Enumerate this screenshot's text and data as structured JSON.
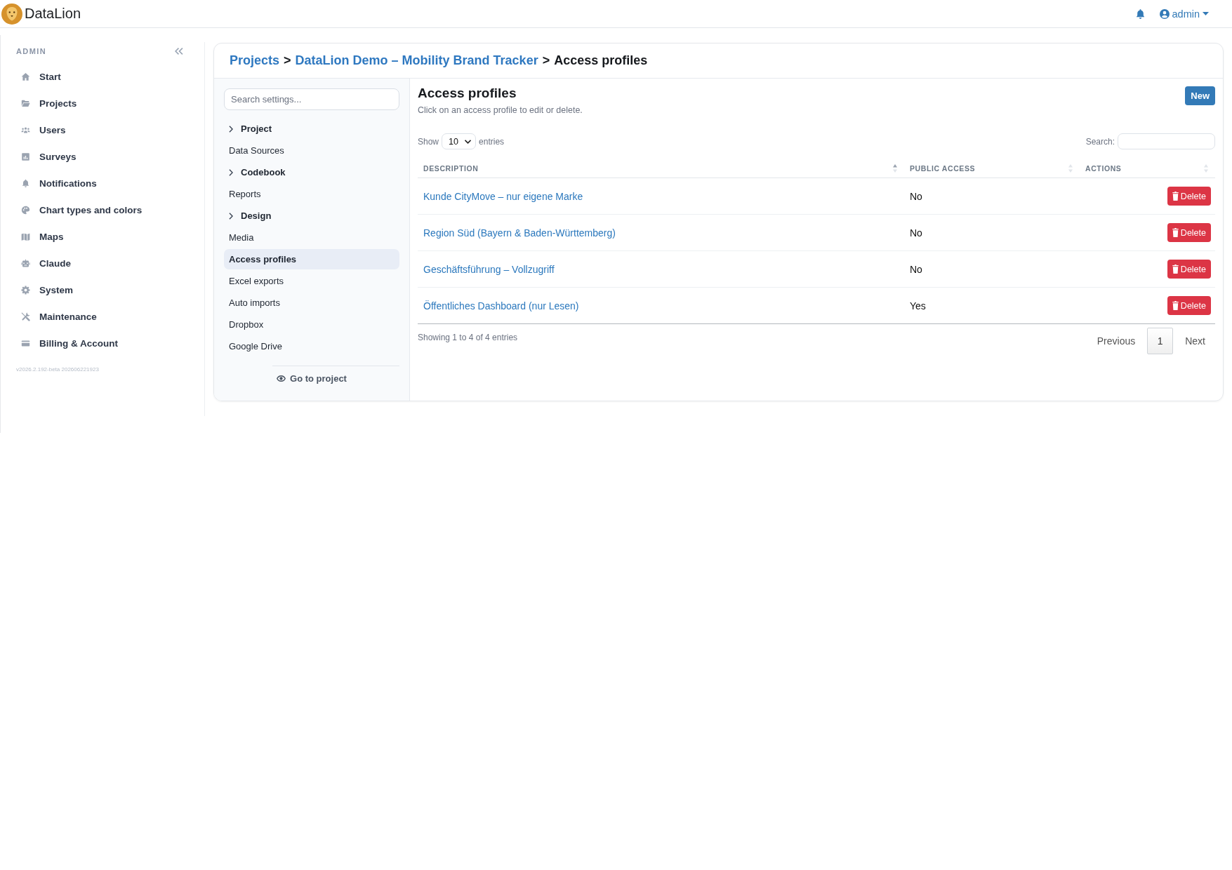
{
  "header": {
    "logo_text": "DataLion",
    "user": "admin"
  },
  "sidebar": {
    "title": "ADMIN",
    "items": [
      {
        "label": "Start",
        "selected": false
      },
      {
        "label": "Projects",
        "selected": false
      },
      {
        "label": "Users",
        "selected": false
      },
      {
        "label": "Surveys",
        "selected": false
      },
      {
        "label": "Notifications",
        "selected": false
      },
      {
        "label": "Chart types and colors",
        "selected": false
      },
      {
        "label": "Maps",
        "selected": false
      },
      {
        "label": "Claude",
        "selected": false
      },
      {
        "label": "System",
        "selected": false
      },
      {
        "label": "Maintenance",
        "selected": false
      },
      {
        "label": "Billing & Account",
        "selected": false
      }
    ],
    "version": "v2026.2.192-beta 202606221923"
  },
  "breadcrumb": [
    {
      "label": "Projects",
      "current": false
    },
    {
      "separator": ">",
      "label": "DataLion Demo – Mobility Brand Tracker",
      "current": false
    },
    {
      "separator": ">",
      "label": "Access profiles",
      "current": true
    }
  ],
  "settings_nav": {
    "search": {
      "placeholder": "Search settings..."
    },
    "items": [
      {
        "kind": "group",
        "label": "Project",
        "expanded": false,
        "selected": false
      },
      {
        "kind": "link",
        "label": "Data Sources",
        "selected": false
      },
      {
        "kind": "group",
        "label": "Codebook",
        "expanded": false,
        "selected": false
      },
      {
        "kind": "link",
        "label": "Reports",
        "selected": false
      },
      {
        "kind": "group",
        "label": "Design",
        "expanded": false,
        "selected": false
      },
      {
        "kind": "link",
        "label": "Media",
        "selected": false
      },
      {
        "kind": "link",
        "label": "Access profiles",
        "selected": true
      },
      {
        "kind": "link",
        "label": "Excel exports",
        "selected": false
      },
      {
        "kind": "link",
        "label": "Auto imports",
        "selected": false
      },
      {
        "kind": "link",
        "label": "Dropbox",
        "selected": false
      },
      {
        "kind": "link",
        "label": "Google Drive",
        "selected": false
      }
    ],
    "footer_link": "Go to project"
  },
  "content": {
    "title": "Access profiles",
    "description": "Click on an access profile to edit or delete.",
    "new_button": "New",
    "length": {
      "label": "Show",
      "value": "10",
      "suffix": "entries"
    },
    "search": {
      "label": "Search:"
    },
    "table": {
      "columns": [
        {
          "label": "DESCRIPTION",
          "sorted": true
        },
        {
          "label": "PUBLIC ACCESS",
          "sorted": false
        },
        {
          "label": "ACTIONS",
          "sorted": false
        }
      ],
      "rows": [
        {
          "description": "Kunde CityMove – nur eigene Marke",
          "public_access": "No",
          "action": "Delete"
        },
        {
          "description": "Region Süd (Bayern & Baden-Württemberg)",
          "public_access": "No",
          "action": "Delete"
        },
        {
          "description": "Geschäftsführung – Vollzugriff",
          "public_access": "No",
          "action": "Delete"
        },
        {
          "description": "Öffentliches Dashboard (nur Lesen)",
          "public_access": "Yes",
          "action": "Delete"
        }
      ]
    },
    "info": "Showing 1 to 4 of 4 entries",
    "pagination": {
      "previous": "Previous",
      "pages": [
        {
          "label": "1",
          "selected": true
        }
      ],
      "next": "Next"
    }
  }
}
